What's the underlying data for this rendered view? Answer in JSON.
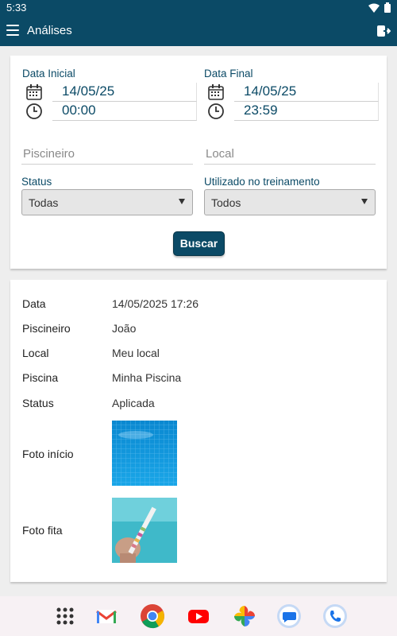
{
  "status_bar": {
    "time": "5:33"
  },
  "app_bar": {
    "title": "Análises"
  },
  "filters": {
    "start_label": "Data Inicial",
    "start_date": "14/05/25",
    "start_time": "00:00",
    "end_label": "Data Final",
    "end_date": "14/05/25",
    "end_time": "23:59",
    "piscineiro_placeholder": "Piscineiro",
    "local_placeholder": "Local",
    "status_label": "Status",
    "status_value": "Todas",
    "treinamento_label": "Utilizado no treinamento",
    "treinamento_value": "Todos",
    "search_button": "Buscar"
  },
  "details": {
    "data_label": "Data",
    "data_value": "14/05/2025 17:26",
    "piscineiro_label": "Piscineiro",
    "piscineiro_value": "João",
    "local_label": "Local",
    "local_value": "Meu local",
    "piscina_label": "Piscina",
    "piscina_value": "Minha Piscina",
    "status_label": "Status",
    "status_value": "Aplicada",
    "foto_inicio_label": "Foto início",
    "foto_fita_label": "Foto fita"
  },
  "colors": {
    "primary": "#0b4a66",
    "background": "#eeeeee"
  },
  "dock_apps": [
    "app-drawer-icon",
    "gmail-icon",
    "chrome-icon",
    "youtube-icon",
    "photos-icon",
    "messages-icon",
    "phone-icon"
  ]
}
